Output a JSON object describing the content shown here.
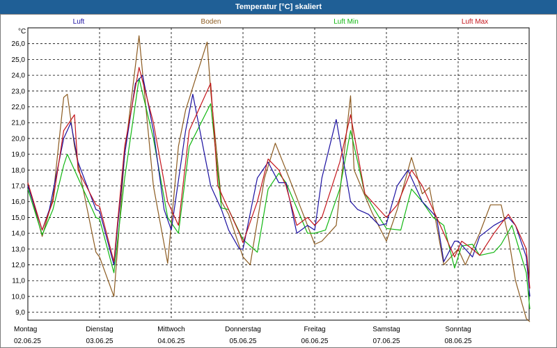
{
  "window": {
    "title": "Temperatur [°C] skaliert"
  },
  "chart_data": {
    "type": "line",
    "ylabel": "°C",
    "ylim": [
      8.5,
      27.0
    ],
    "yticks": [
      "9,0",
      "10,0",
      "11,0",
      "12,0",
      "13,0",
      "14,0",
      "15,0",
      "16,0",
      "17,0",
      "18,0",
      "19,0",
      "20,0",
      "21,0",
      "22,0",
      "23,0",
      "24,0",
      "25,0",
      "26,0"
    ],
    "ytick_values": [
      9,
      10,
      11,
      12,
      13,
      14,
      15,
      16,
      17,
      18,
      19,
      20,
      21,
      22,
      23,
      24,
      25,
      26
    ],
    "xlim": [
      0,
      7.0
    ],
    "xticks": [
      {
        "day": "Montag",
        "date": "02.06.25"
      },
      {
        "day": "Dienstag",
        "date": "03.06.25"
      },
      {
        "day": "Mittwoch",
        "date": "04.06.25"
      },
      {
        "day": "Donnerstag",
        "date": "05.06.25"
      },
      {
        "day": "Freitag",
        "date": "06.06.25"
      },
      {
        "day": "Samstag",
        "date": "07.06.25"
      },
      {
        "day": "Sonntag",
        "date": "08.06.25"
      }
    ],
    "grid": true,
    "legend_position": "top",
    "series": [
      {
        "name": "Luft",
        "color": "#1a0fa0",
        "x": [
          0,
          0.2,
          0.3,
          0.5,
          0.6,
          0.7,
          0.95,
          1.0,
          1.2,
          1.35,
          1.5,
          1.6,
          1.75,
          1.9,
          2.0,
          2.2,
          2.3,
          2.55,
          2.7,
          2.8,
          2.95,
          3.0,
          3.2,
          3.35,
          3.5,
          3.6,
          3.75,
          3.9,
          4.0,
          4.1,
          4.3,
          4.5,
          4.6,
          4.75,
          4.9,
          5.0,
          5.15,
          5.3,
          5.5,
          5.7,
          5.8,
          5.95,
          6.0,
          6.2,
          6.3,
          6.5,
          6.7,
          6.8,
          6.95,
          7.0
        ],
        "y": [
          17.0,
          14.2,
          15.5,
          20.0,
          21.0,
          18.5,
          15.5,
          15.4,
          12.0,
          19.0,
          23.5,
          24.0,
          20.5,
          15.5,
          14.2,
          20.5,
          22.8,
          17.0,
          15.5,
          14.2,
          13.0,
          13.0,
          17.5,
          18.5,
          17.2,
          17.2,
          14.0,
          14.5,
          14.2,
          17.5,
          21.2,
          16.0,
          15.5,
          15.2,
          14.5,
          14.6,
          17.0,
          18.0,
          16.0,
          15.0,
          12.2,
          13.5,
          13.5,
          12.5,
          13.8,
          14.5,
          15.0,
          14.5,
          12.5,
          10.0
        ]
      },
      {
        "name": "Boden",
        "color": "#8b5a1f",
        "x": [
          0,
          0.2,
          0.35,
          0.5,
          0.55,
          0.65,
          0.95,
          1.0,
          1.2,
          1.35,
          1.55,
          1.75,
          1.95,
          2.1,
          2.2,
          2.5,
          2.55,
          2.7,
          2.8,
          3.0,
          3.1,
          3.3,
          3.45,
          3.6,
          3.9,
          4.0,
          4.1,
          4.3,
          4.5,
          4.55,
          4.8,
          5.0,
          5.15,
          5.35,
          5.5,
          5.6,
          5.7,
          5.8,
          6.0,
          6.1,
          6.3,
          6.45,
          6.6,
          6.7,
          6.8,
          6.95,
          7.0
        ],
        "y": [
          17.2,
          13.8,
          16.2,
          22.6,
          22.8,
          19.5,
          12.8,
          12.5,
          10.0,
          19.0,
          26.5,
          17.0,
          12.1,
          19.5,
          21.8,
          26.1,
          23.0,
          16.0,
          15.2,
          12.5,
          12.0,
          17.5,
          19.7,
          18.0,
          14.5,
          13.3,
          13.5,
          14.5,
          22.7,
          18.0,
          15.3,
          13.5,
          15.5,
          18.8,
          16.5,
          16.9,
          14.5,
          12.0,
          13.0,
          12.0,
          14.0,
          15.8,
          15.8,
          13.8,
          11.0,
          8.6,
          8.4
        ]
      },
      {
        "name": "Luft Min",
        "color": "#11b711",
        "x": [
          0,
          0.2,
          0.35,
          0.5,
          0.55,
          0.65,
          0.95,
          1.0,
          1.2,
          1.35,
          1.55,
          1.75,
          1.95,
          2.1,
          2.25,
          2.55,
          2.7,
          2.8,
          3.0,
          3.2,
          3.35,
          3.5,
          3.6,
          3.9,
          4.0,
          4.15,
          4.35,
          4.5,
          4.7,
          4.9,
          5.0,
          5.2,
          5.35,
          5.5,
          5.65,
          5.8,
          5.95,
          6.05,
          6.2,
          6.3,
          6.5,
          6.6,
          6.75,
          6.95,
          7.0
        ],
        "y": [
          16.8,
          13.9,
          15.5,
          18.3,
          19.0,
          18.0,
          15.0,
          14.9,
          11.5,
          17.5,
          23.8,
          20.0,
          15.0,
          14.0,
          19.5,
          22.2,
          15.6,
          15.5,
          13.6,
          12.8,
          16.8,
          17.8,
          17.2,
          14.0,
          14.0,
          14.2,
          16.8,
          20.5,
          16.5,
          15.0,
          14.3,
          14.2,
          16.8,
          16.0,
          15.0,
          14.5,
          11.8,
          13.2,
          13.3,
          12.6,
          12.8,
          13.3,
          14.5,
          11.5,
          9.2
        ]
      },
      {
        "name": "Luft Max",
        "color": "#c4141b",
        "x": [
          0,
          0.2,
          0.35,
          0.5,
          0.65,
          0.7,
          0.95,
          1.0,
          1.2,
          1.35,
          1.55,
          1.75,
          1.95,
          2.1,
          2.25,
          2.55,
          2.65,
          2.8,
          2.95,
          3.0,
          3.2,
          3.35,
          3.5,
          3.6,
          3.75,
          3.9,
          4.0,
          4.1,
          4.35,
          4.5,
          4.7,
          4.9,
          5.0,
          5.15,
          5.35,
          5.5,
          5.65,
          5.8,
          5.95,
          6.05,
          6.2,
          6.3,
          6.5,
          6.7,
          6.8,
          6.95,
          7.0
        ],
        "y": [
          17.2,
          14.2,
          16.0,
          20.5,
          21.5,
          18.0,
          15.8,
          15.7,
          12.2,
          19.5,
          24.5,
          21.0,
          16.0,
          14.5,
          20.5,
          23.5,
          17.0,
          15.5,
          14.0,
          13.4,
          16.0,
          18.7,
          18.0,
          17.0,
          14.5,
          15.0,
          14.5,
          15.0,
          18.5,
          21.5,
          16.5,
          15.5,
          15.0,
          15.8,
          18.0,
          17.0,
          15.5,
          14.0,
          12.5,
          13.5,
          13.0,
          12.6,
          14.0,
          15.2,
          14.5,
          13.0,
          10.5
        ]
      }
    ]
  }
}
